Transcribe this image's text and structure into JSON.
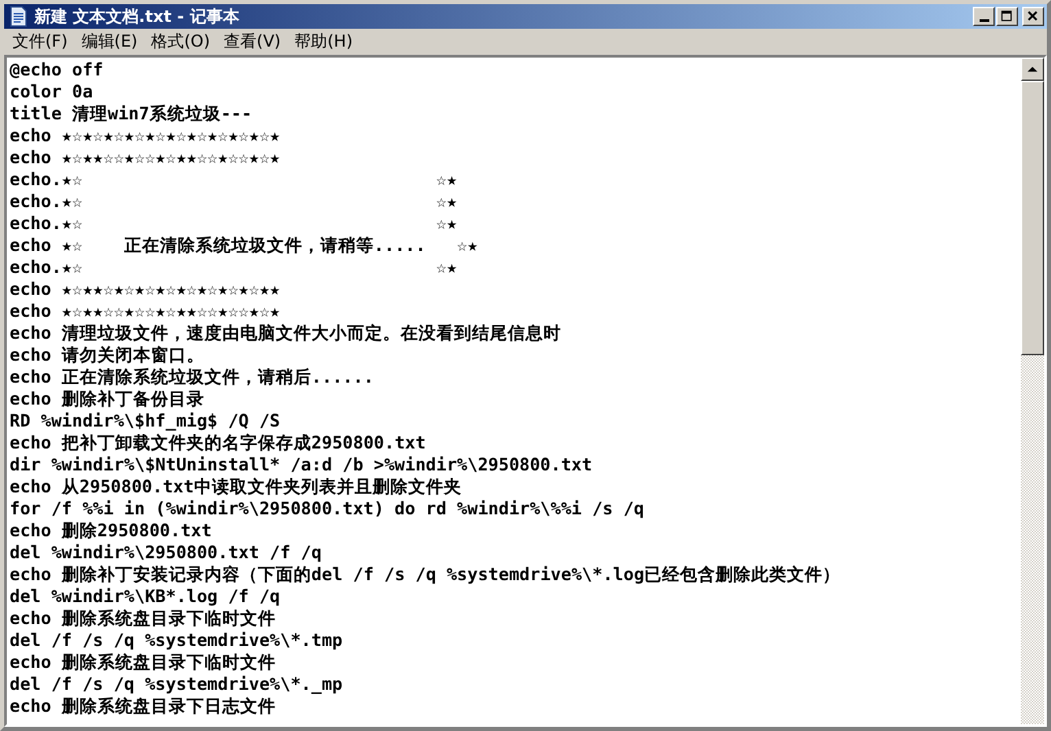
{
  "window": {
    "title": "新建 文本文档.txt - 记事本"
  },
  "menu": [
    {
      "label": "文件(F)"
    },
    {
      "label": "编辑(E)"
    },
    {
      "label": "格式(O)"
    },
    {
      "label": "查看(V)"
    },
    {
      "label": "帮助(H)"
    }
  ],
  "editor": {
    "lines": [
      "@echo off",
      "color 0a",
      "title 清理win7系统垃圾---",
      "echo ★☆★☆★☆★☆★☆★☆★☆★☆★☆★☆★",
      "echo ★☆★★☆☆★☆☆★☆★★☆☆★☆☆★☆★",
      "echo.★☆                                  ☆★",
      "echo.★☆                                  ☆★",
      "echo.★☆                                  ☆★",
      "echo ★☆    正在清除系统垃圾文件，请稍等.....   ☆★",
      "echo.★☆                                  ☆★",
      "echo ★☆★★☆★☆★☆★☆★☆★☆★☆★☆★★",
      "echo ★☆★★☆☆★☆☆★☆★★☆☆★☆☆★☆★",
      "echo 清理垃圾文件，速度由电脑文件大小而定。在没看到结尾信息时",
      "echo 请勿关闭本窗口。",
      "echo 正在清除系统垃圾文件，请稍后......",
      "echo 删除补丁备份目录",
      "RD %windir%\\$hf_mig$ /Q /S",
      "echo 把补丁卸载文件夹的名字保存成2950800.txt",
      "dir %windir%\\$NtUninstall* /a:d /b >%windir%\\2950800.txt",
      "echo 从2950800.txt中读取文件夹列表并且删除文件夹",
      "for /f %%i in (%windir%\\2950800.txt) do rd %windir%\\%%i /s /q",
      "echo 删除2950800.txt",
      "del %windir%\\2950800.txt /f /q",
      "echo 删除补丁安装记录内容（下面的del /f /s /q %systemdrive%\\*.log已经包含删除此类文件）",
      "del %windir%\\KB*.log /f /q",
      "echo 删除系统盘目录下临时文件",
      "del /f /s /q %systemdrive%\\*.tmp",
      "echo 删除系统盘目录下临时文件",
      "del /f /s /q %systemdrive%\\*._mp",
      "echo 删除系统盘目录下日志文件"
    ]
  }
}
